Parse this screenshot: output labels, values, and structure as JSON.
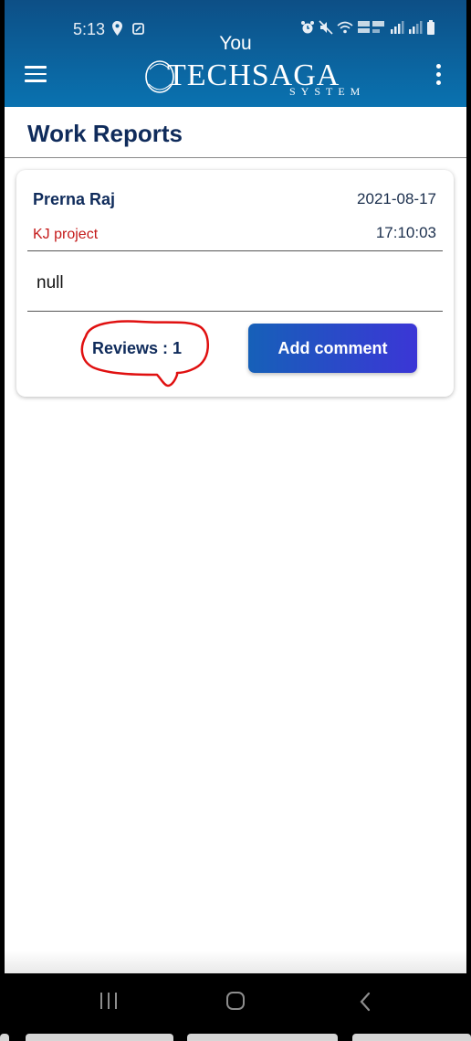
{
  "status_bar": {
    "time": "5:13",
    "icons": [
      "location-icon",
      "card-icon",
      "alarm-icon",
      "mute-icon",
      "wifi-icon",
      "volte-lte-icon",
      "signal-icon",
      "signal-icon",
      "battery-icon"
    ]
  },
  "app_bar": {
    "user_label": "You",
    "logo_text": "TECHSAGA",
    "logo_sub": "SYSTEM",
    "menu_icon": "hamburger-icon",
    "overflow_icon": "more-vert-icon",
    "color": "#0a6aa8"
  },
  "page": {
    "title": "Work Reports"
  },
  "reports": [
    {
      "author": "Prerna Raj",
      "date": "2021-08-17",
      "project": "KJ project",
      "time": "17:10:03",
      "description": "null",
      "reviews_label": "Reviews : 1",
      "add_comment_label": "Add comment"
    }
  ],
  "colors": {
    "title": "#0f2b5b",
    "project": "#c41a1a",
    "button_start": "#1660b8",
    "button_end": "#3b36d6",
    "annotation": "#e01010"
  },
  "nav_bar": {
    "icons": [
      "recents-icon",
      "home-icon",
      "back-icon"
    ]
  }
}
